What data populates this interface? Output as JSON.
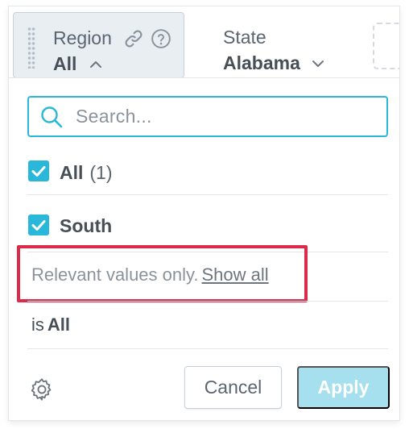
{
  "filters": [
    {
      "label": "Region",
      "value": "All",
      "expanded": true
    },
    {
      "label": "State",
      "value": "Alabama",
      "expanded": false
    }
  ],
  "dropdown": {
    "search_placeholder": "Search...",
    "options": [
      {
        "label": "All",
        "count": "(1)",
        "checked": true
      },
      {
        "label": "South",
        "checked": true
      }
    ],
    "relevant_text": "Relevant values only.",
    "show_all_link": "Show all",
    "summary_prefix": "is",
    "summary_value": "All",
    "cancel_label": "Cancel",
    "apply_label": "Apply"
  },
  "colors": {
    "accent": "#29b8d9",
    "apply_disabled": "#a6dfee",
    "highlight": "#dd2a4b"
  },
  "icons": {
    "link": "link-icon",
    "help": "question-circle-icon",
    "search": "search-icon",
    "settings": "gear-icon"
  }
}
